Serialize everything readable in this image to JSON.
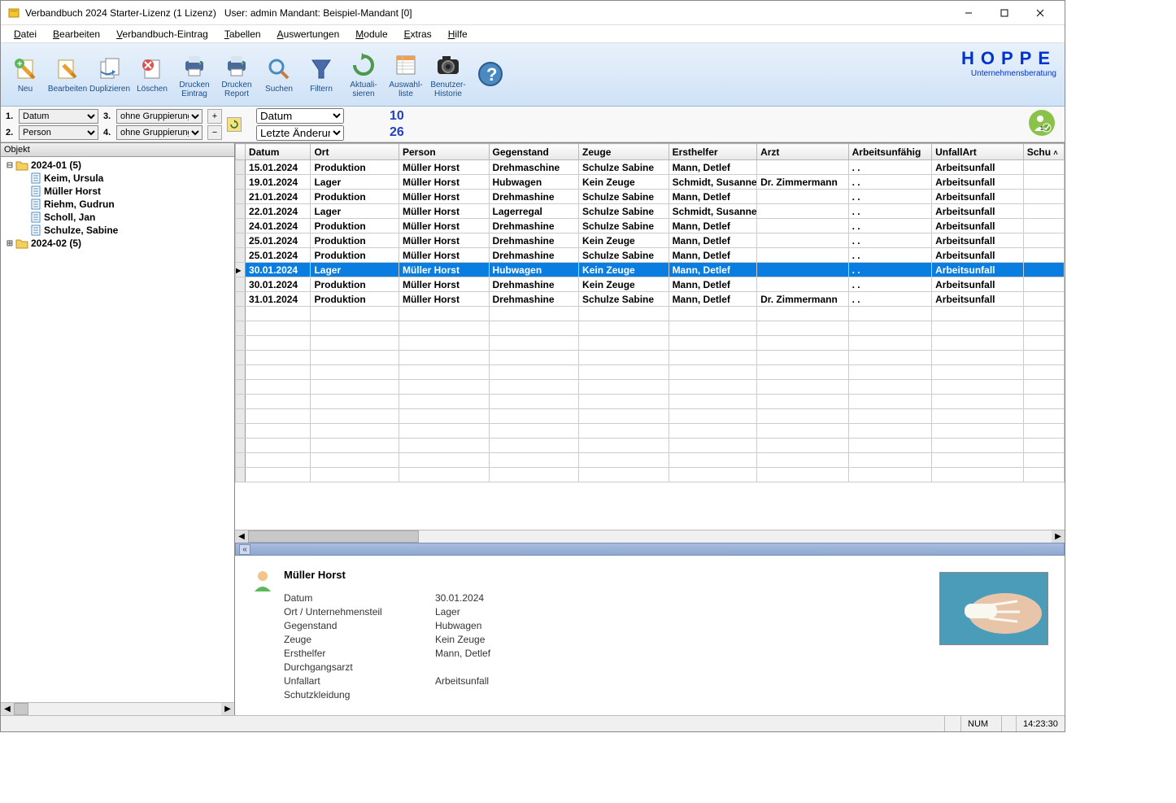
{
  "window": {
    "title": "Verbandbuch 2024 Starter-Lizenz (1 Lizenz)",
    "user_label": "User: admin Mandant: Beispiel-Mandant [0]"
  },
  "menu": [
    "Datei",
    "Bearbeiten",
    "Verbandbuch-Eintrag",
    "Tabellen",
    "Auswertungen",
    "Module",
    "Extras",
    "Hilfe"
  ],
  "toolbar": [
    {
      "label": "Neu",
      "icon": "doc-plus"
    },
    {
      "label": "Bearbeiten",
      "icon": "doc-edit"
    },
    {
      "label": "Duplizieren",
      "icon": "doc-dup"
    },
    {
      "label": "Löschen",
      "icon": "doc-del"
    },
    {
      "label": "Drucken\nEintrag",
      "icon": "print"
    },
    {
      "label": "Drucken\nReport",
      "icon": "print"
    },
    {
      "label": "Suchen",
      "icon": "search"
    },
    {
      "label": "Filtern",
      "icon": "funnel"
    },
    {
      "label": "Aktuali-\nsieren",
      "icon": "refresh"
    },
    {
      "label": "Auswahl-\nliste",
      "icon": "list"
    },
    {
      "label": "Benutzer-\nHistorie",
      "icon": "camera"
    },
    {
      "label": "",
      "icon": "help"
    }
  ],
  "brand": {
    "line1": "HOPPE",
    "line2": "Unternehmensberatung"
  },
  "filter": {
    "g1": {
      "label": "1.",
      "value": "Datum"
    },
    "g2": {
      "label": "2.",
      "value": "Person"
    },
    "g3": {
      "label": "3.",
      "value": "ohne Gruppierung"
    },
    "g4": {
      "label": "4.",
      "value": "ohne Gruppierung"
    },
    "sort1": "Datum",
    "sort2": "Letzte Änderung",
    "count1": "10",
    "count2": "26"
  },
  "tree": {
    "header": "Objekt",
    "nodes": [
      {
        "type": "folder",
        "label": "2024-01  (5)",
        "expanded": true,
        "children": [
          {
            "label": "Keim, Ursula"
          },
          {
            "label": "Müller Horst"
          },
          {
            "label": "Riehm, Gudrun"
          },
          {
            "label": "Scholl, Jan"
          },
          {
            "label": "Schulze, Sabine"
          }
        ]
      },
      {
        "type": "folder",
        "label": "2024-02  (5)",
        "expanded": false,
        "children": []
      }
    ]
  },
  "grid": {
    "columns": [
      "Datum",
      "Ort",
      "Person",
      "Gegenstand",
      "Zeuge",
      "Ersthelfer",
      "Arzt",
      "Arbeitsunfähig",
      "UnfallArt",
      "Schu"
    ],
    "widths": [
      80,
      108,
      110,
      110,
      110,
      108,
      112,
      102,
      112,
      50
    ],
    "rows": [
      [
        "15.01.2024",
        "Produktion",
        "Müller Horst",
        "Drehmaschine",
        "Schulze Sabine",
        "Mann, Detlef",
        "",
        ".  .",
        "Arbeitsunfall",
        ""
      ],
      [
        "19.01.2024",
        "Lager",
        "Müller Horst",
        "Hubwagen",
        "Kein Zeuge",
        "Schmidt, Susanne",
        "Dr. Zimmermann",
        ".  .",
        "Arbeitsunfall",
        ""
      ],
      [
        "21.01.2024",
        "Produktion",
        "Müller Horst",
        "Drehmashine",
        "Schulze Sabine",
        "Mann, Detlef",
        "",
        ".  .",
        "Arbeitsunfall",
        ""
      ],
      [
        "22.01.2024",
        "Lager",
        "Müller Horst",
        "Lagerregal",
        "Schulze Sabine",
        "Schmidt, Susanne",
        "",
        ".  .",
        "Arbeitsunfall",
        ""
      ],
      [
        "24.01.2024",
        "Produktion",
        "Müller Horst",
        "Drehmashine",
        "Schulze Sabine",
        "Mann, Detlef",
        "",
        ".  .",
        "Arbeitsunfall",
        ""
      ],
      [
        "25.01.2024",
        "Produktion",
        "Müller Horst",
        "Drehmashine",
        "Kein Zeuge",
        "Mann, Detlef",
        "",
        ".  .",
        "Arbeitsunfall",
        ""
      ],
      [
        "25.01.2024",
        "Produktion",
        "Müller Horst",
        "Drehmashine",
        "Schulze Sabine",
        "Mann, Detlef",
        "",
        ".  .",
        "Arbeitsunfall",
        ""
      ],
      [
        "30.01.2024",
        "Lager",
        "Müller Horst",
        "Hubwagen",
        "Kein Zeuge",
        "Mann, Detlef",
        "",
        ".  .",
        "Arbeitsunfall",
        ""
      ],
      [
        "30.01.2024",
        "Produktion",
        "Müller Horst",
        "Drehmashine",
        "Kein Zeuge",
        "Mann, Detlef",
        "",
        ".  .",
        "Arbeitsunfall",
        ""
      ],
      [
        "31.01.2024",
        "Produktion",
        "Müller Horst",
        "Drehmashine",
        "Schulze Sabine",
        "Mann, Detlef",
        "Dr. Zimmermann",
        ".  .",
        "Arbeitsunfall",
        ""
      ]
    ],
    "selected_index": 7,
    "empty_rows": 12
  },
  "detail": {
    "name": "Müller Horst",
    "fields": [
      {
        "label": "Datum",
        "value": "30.01.2024"
      },
      {
        "label": "Ort / Unternehmensteil",
        "value": "Lager"
      },
      {
        "label": "Gegenstand",
        "value": "Hubwagen"
      },
      {
        "label": "Zeuge",
        "value": "Kein Zeuge"
      },
      {
        "label": "Ersthelfer",
        "value": "Mann, Detlef"
      },
      {
        "label": "Durchgangsarzt",
        "value": ""
      },
      {
        "label": "Unfallart",
        "value": "Arbeitsunfall"
      },
      {
        "label": "Schutzkleidung",
        "value": ""
      }
    ]
  },
  "status": {
    "num": "NUM",
    "time": "14:23:30"
  }
}
